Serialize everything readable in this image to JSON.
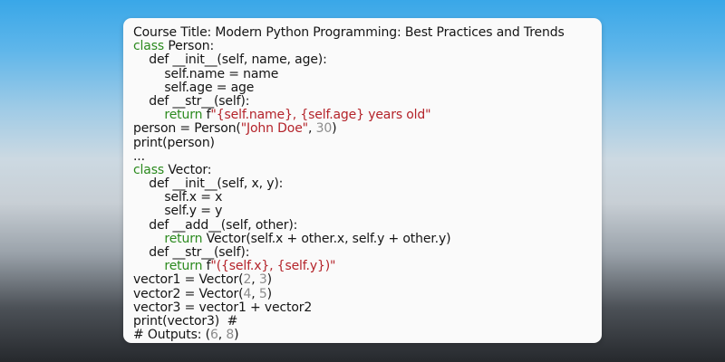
{
  "course_title": "Course Title: Modern Python Programming: Best Practices and Trends",
  "colors": {
    "keyword": "#2b8a1e",
    "string": "#b4232a",
    "number": "#8c8c8c",
    "text": "#151515",
    "card_background": "#fafafa"
  },
  "code": [
    [
      {
        "t": "class",
        "c": "kw"
      },
      {
        "t": " Person:"
      }
    ],
    [
      {
        "t": "    def __init__(self, name, age):"
      }
    ],
    [
      {
        "t": "        self.name = name"
      }
    ],
    [
      {
        "t": "        self.age = age"
      }
    ],
    [
      {
        "t": "    def __str__(self):"
      }
    ],
    [
      {
        "t": "        "
      },
      {
        "t": "return",
        "c": "kw"
      },
      {
        "t": " f"
      },
      {
        "t": "\"{self.name}, {self.age} years old\"",
        "c": "str"
      }
    ],
    [
      {
        "t": "person = Person("
      },
      {
        "t": "\"John Doe\"",
        "c": "str"
      },
      {
        "t": ", "
      },
      {
        "t": "30",
        "c": "num"
      },
      {
        "t": ")"
      }
    ],
    [
      {
        "t": "print(person)"
      }
    ],
    [
      {
        "t": "..."
      }
    ],
    [
      {
        "t": "class",
        "c": "kw"
      },
      {
        "t": " Vector:"
      }
    ],
    [
      {
        "t": "    def __init__(self, x, y):"
      }
    ],
    [
      {
        "t": "        self.x = x"
      }
    ],
    [
      {
        "t": "        self.y = y"
      }
    ],
    [
      {
        "t": "    def __add__(self, other):"
      }
    ],
    [
      {
        "t": "        "
      },
      {
        "t": "return",
        "c": "kw"
      },
      {
        "t": " Vector(self.x + other.x, self.y + other.y)"
      }
    ],
    [
      {
        "t": "    def __str__(self):"
      }
    ],
    [
      {
        "t": "        "
      },
      {
        "t": "return",
        "c": "kw"
      },
      {
        "t": " f"
      },
      {
        "t": "\"({self.x}, {self.y})\"",
        "c": "str"
      }
    ],
    [
      {
        "t": "vector1 = Vector("
      },
      {
        "t": "2",
        "c": "num"
      },
      {
        "t": ", "
      },
      {
        "t": "3",
        "c": "num"
      },
      {
        "t": ")"
      }
    ],
    [
      {
        "t": "vector2 = Vector("
      },
      {
        "t": "4",
        "c": "num"
      },
      {
        "t": ", "
      },
      {
        "t": "5",
        "c": "num"
      },
      {
        "t": ")"
      }
    ],
    [
      {
        "t": "vector3 = vector1 + vector2"
      }
    ],
    [
      {
        "t": "print(vector3)  #"
      }
    ],
    [
      {
        "t": "# Outputs: ("
      },
      {
        "t": "6",
        "c": "num"
      },
      {
        "t": ", "
      },
      {
        "t": "8",
        "c": "num"
      },
      {
        "t": ")"
      }
    ],
    [
      {
        "t": "..."
      }
    ]
  ]
}
